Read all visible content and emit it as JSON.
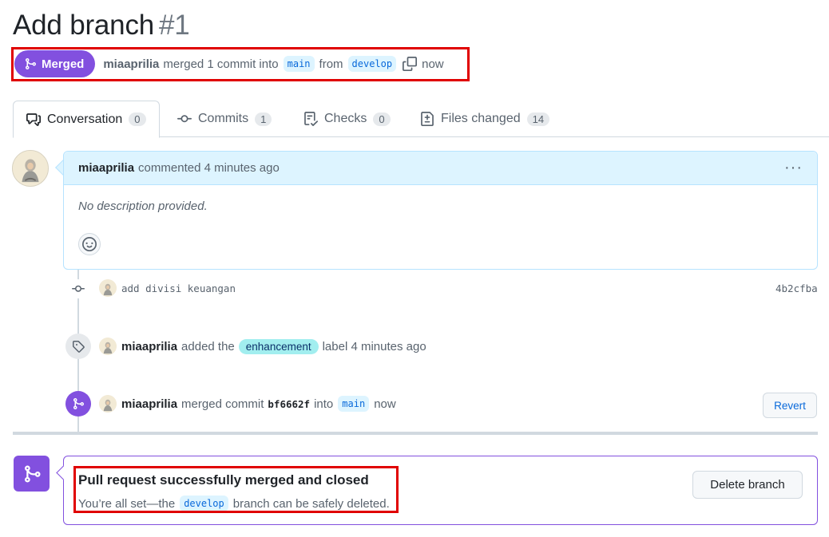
{
  "pr": {
    "title": "Add branch",
    "number": "#1"
  },
  "header": {
    "status": "Merged",
    "author": "miaaprilia",
    "merged_text": "merged 1 commit into",
    "base_branch": "main",
    "from_text": "from",
    "head_branch": "develop",
    "time": "now"
  },
  "tabs": [
    {
      "label": "Conversation",
      "count": "0",
      "icon": "comment-discussion-icon"
    },
    {
      "label": "Commits",
      "count": "1",
      "icon": "git-commit-icon"
    },
    {
      "label": "Checks",
      "count": "0",
      "icon": "checklist-icon"
    },
    {
      "label": "Files changed",
      "count": "14",
      "icon": "file-diff-icon"
    }
  ],
  "comment": {
    "author": "miaaprilia",
    "action": "commented 4 minutes ago",
    "menu": "···",
    "body": "No description provided."
  },
  "timeline": {
    "commit": {
      "message": "add divisi keuangan",
      "sha": "4b2cfba"
    },
    "label_event": {
      "author": "miaaprilia",
      "pre": "added the",
      "label": "enhancement",
      "post": "label 4 minutes ago",
      "label_color": "#a2eeef"
    },
    "merge_event": {
      "author": "miaaprilia",
      "pre": "merged commit",
      "sha": "bf6662f",
      "into": "into",
      "branch": "main",
      "time": "now",
      "revert_label": "Revert"
    }
  },
  "merge_status": {
    "title": "Pull request successfully merged and closed",
    "sub_pre": "You’re all set—the",
    "branch": "develop",
    "sub_post": "branch can be safely deleted.",
    "delete_label": "Delete branch"
  },
  "colors": {
    "merged": "#8250df",
    "annotation": "#e00000",
    "link": "#0969da"
  }
}
